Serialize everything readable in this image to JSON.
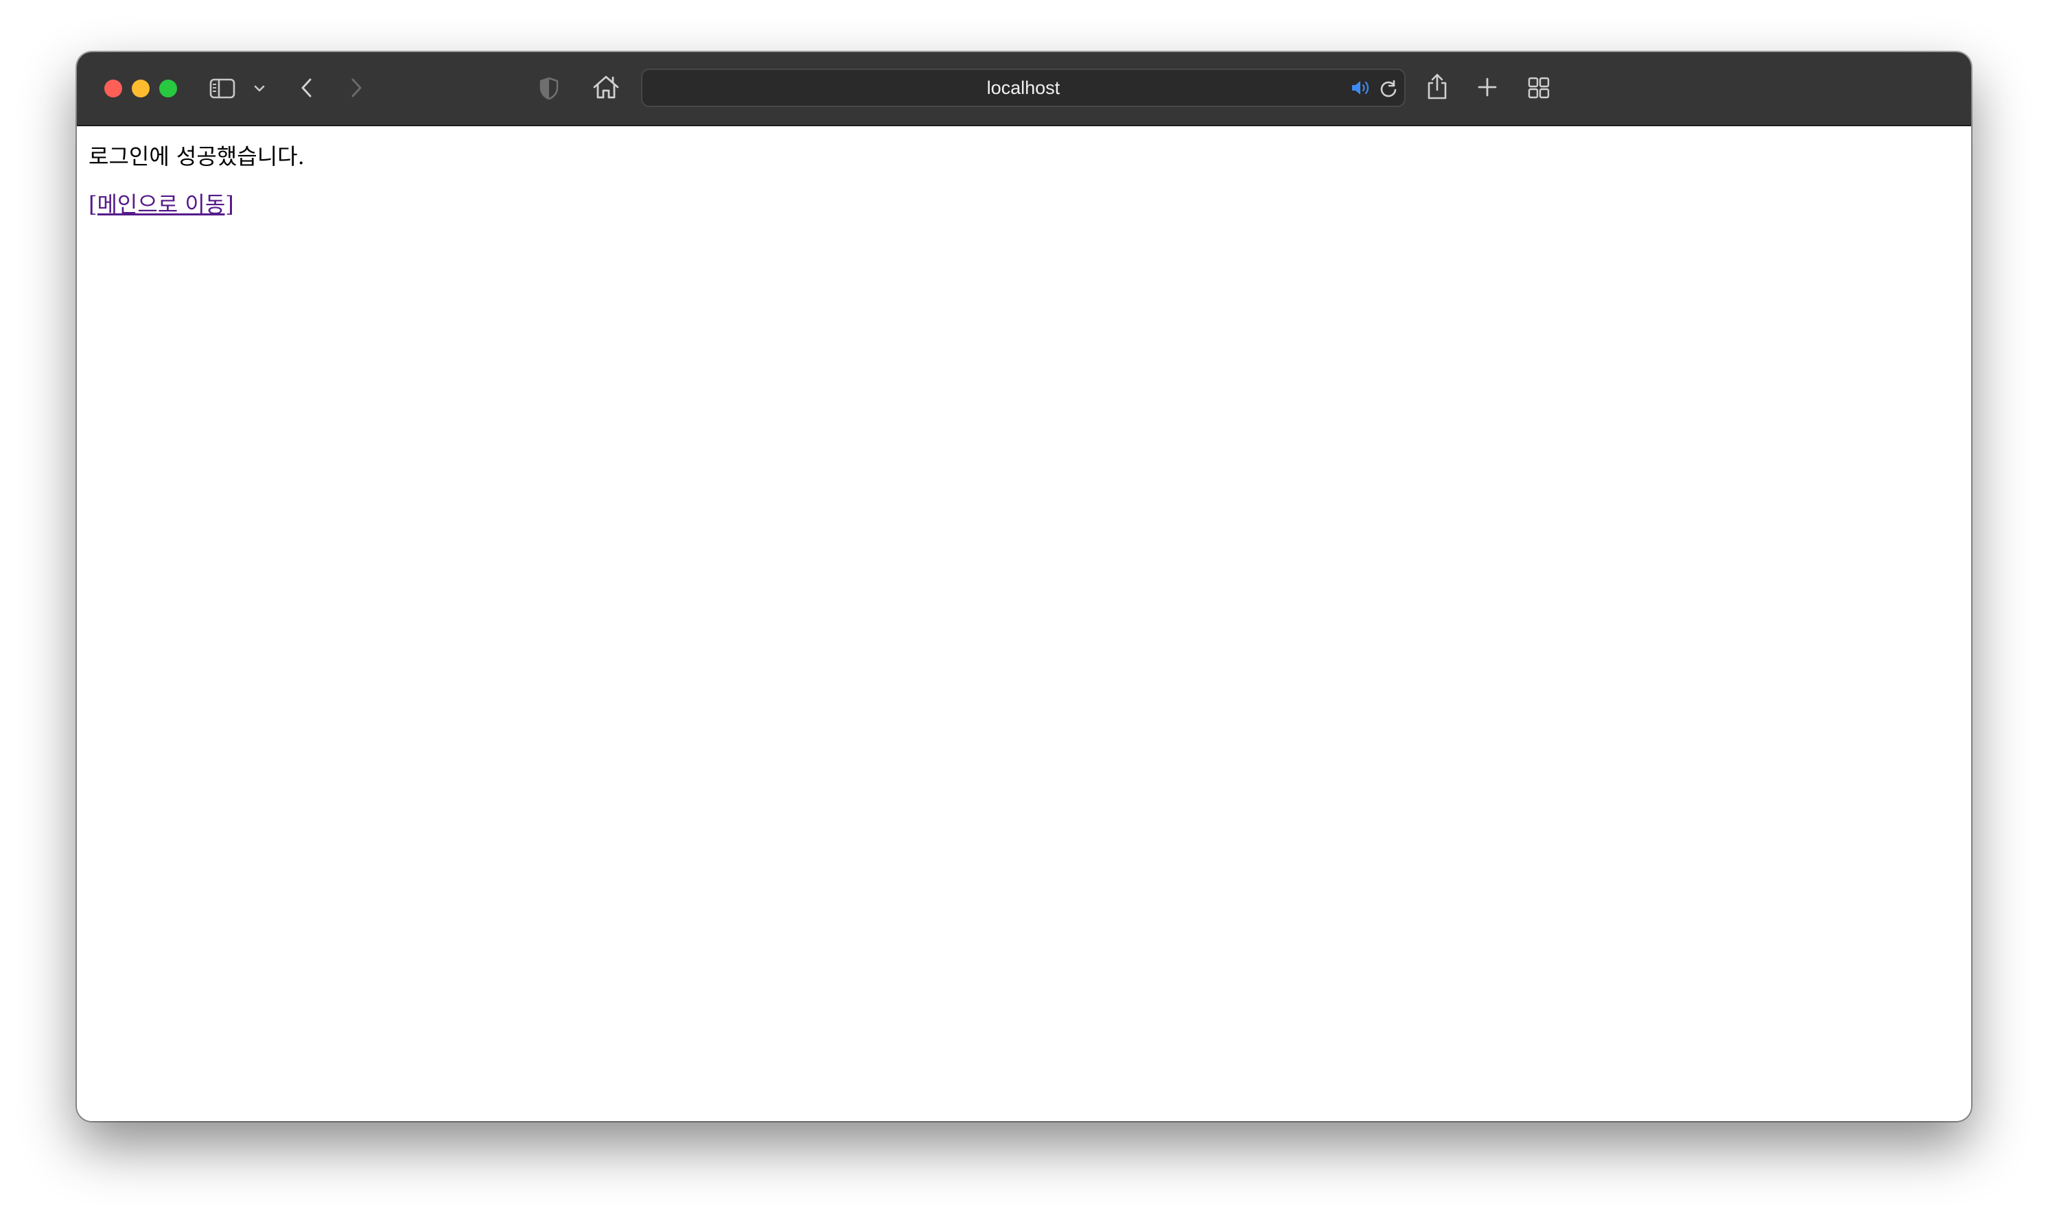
{
  "browser": {
    "url": "localhost",
    "colors": {
      "toolbar": "#363636",
      "close": "#fe5f57",
      "minimize": "#febc2e",
      "maximize": "#28c840",
      "audio_icon": "#3d8bf2"
    },
    "icons": [
      "sidebar-icon",
      "chevron-down-icon",
      "back-icon",
      "forward-icon",
      "privacy-shield-icon",
      "home-icon",
      "audio-icon",
      "reload-icon",
      "share-icon",
      "new-tab-icon",
      "tab-overview-icon"
    ]
  },
  "page": {
    "message": "로그인에 성공했습니다.",
    "main_link": "[메인으로 이동]",
    "colors": {
      "link": "#551a8b"
    }
  }
}
